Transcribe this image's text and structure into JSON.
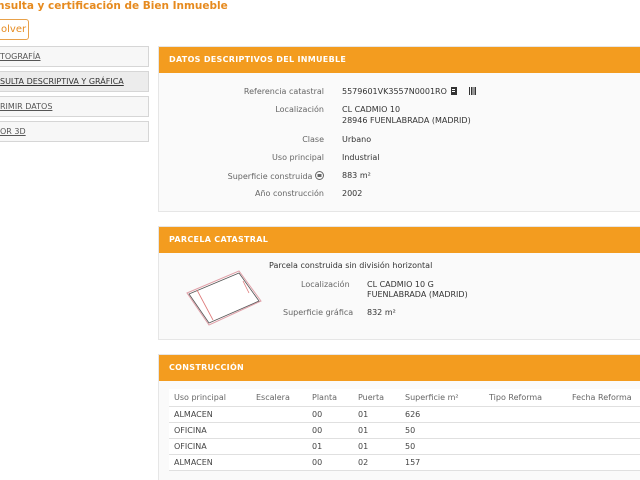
{
  "header": {
    "title": "nsulta y certificación de Bien Inmueble",
    "back_label": "olver"
  },
  "sidebar": {
    "items": [
      {
        "label": "TOGRAFÍA"
      },
      {
        "label": "SULTA DESCRIPTIVA Y GRÁFICA"
      },
      {
        "label": "RIMIR DATOS"
      },
      {
        "label": "OR 3D"
      }
    ]
  },
  "datos": {
    "header": "DATOS DESCRIPTIVOS DEL INMUEBLE",
    "ref_label": "Referencia catastral",
    "ref_value": "5579601VK3557N0001RO",
    "loc_label": "Localización",
    "loc_line1": "CL CADMIO 10",
    "loc_line2": "28946 FUENLABRADA (MADRID)",
    "clase_label": "Clase",
    "clase_value": "Urbano",
    "uso_label": "Uso principal",
    "uso_value": "Industrial",
    "sup_label": "Superficie construida",
    "sup_value": "883 m²",
    "anio_label": "Año construcción",
    "anio_value": "2002"
  },
  "parcela": {
    "header": "PARCELA CATASTRAL",
    "desc": "Parcela construida sin división horizontal",
    "loc_label": "Localización",
    "loc_line1": "CL CADMIO 10 G",
    "loc_line2": "FUENLABRADA (MADRID)",
    "sup_label": "Superficie gráfica",
    "sup_value": "832 m²"
  },
  "construccion": {
    "header": "CONSTRUCCIÓN",
    "columns": [
      "Uso principal",
      "Escalera",
      "Planta",
      "Puerta",
      "Superficie m²",
      "Tipo Reforma",
      "Fecha Reforma"
    ],
    "rows": [
      [
        "ALMACEN",
        "",
        "00",
        "01",
        "626",
        "",
        ""
      ],
      [
        "OFICINA",
        "",
        "00",
        "01",
        "50",
        "",
        ""
      ],
      [
        "OFICINA",
        "",
        "01",
        "01",
        "50",
        "",
        ""
      ],
      [
        "ALMACEN",
        "",
        "00",
        "02",
        "157",
        "",
        ""
      ]
    ]
  },
  "colors": {
    "accent": "#f39c1f",
    "title": "#e68a1e"
  }
}
